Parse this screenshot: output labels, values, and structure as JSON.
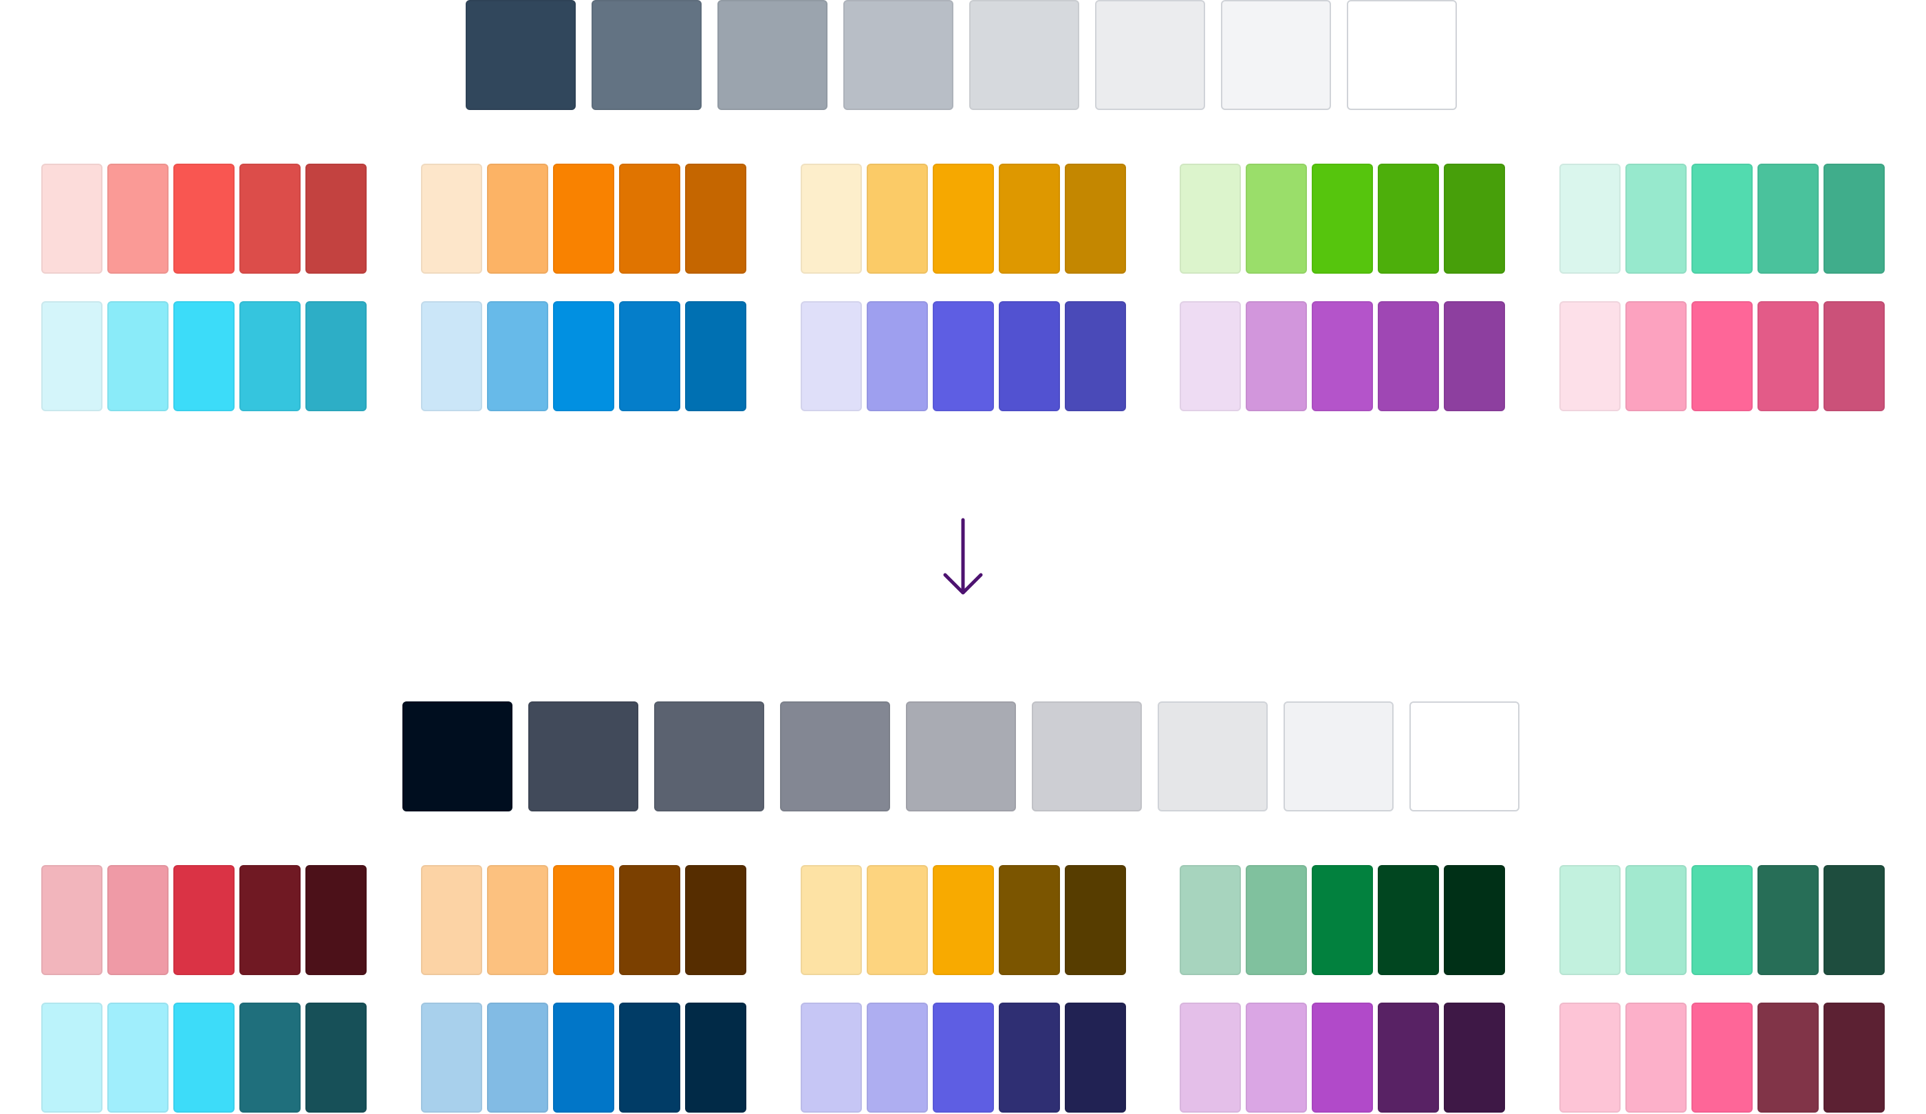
{
  "before": {
    "grays": [
      "#31475c",
      "#637383",
      "#9ba4ae",
      "#b8bec6",
      "#d6d9dd",
      "#ebecee",
      "#f3f4f6",
      "#ffffff"
    ],
    "rows": [
      [
        [
          "#fcdcda",
          "#fa9a96",
          "#f95651",
          "#dc4d4a",
          "#c34240"
        ],
        [
          "#fde6ca",
          "#fcb365",
          "#f98200",
          "#e07400",
          "#c56600"
        ],
        [
          "#fdeecb",
          "#fbcb67",
          "#f6a800",
          "#de9800",
          "#c48700"
        ],
        [
          "#dcf4cc",
          "#9ade6a",
          "#56c50d",
          "#4daf0b",
          "#479f0a"
        ],
        [
          "#daf6ed",
          "#97e9cd",
          "#52dbaf",
          "#4ac29c",
          "#40ad8b"
        ]
      ],
      [
        [
          "#d4f5fa",
          "#8aebf9",
          "#3cdcf9",
          "#35c5de",
          "#2daec6"
        ],
        [
          "#cbe6f8",
          "#67bae9",
          "#0190e1",
          "#057eca",
          "#0070b2"
        ],
        [
          "#dfdff9",
          "#9e9fef",
          "#5e5ee3",
          "#5252d1",
          "#4a4ab8"
        ],
        [
          "#eedcf3",
          "#d296dc",
          "#b454ca",
          "#9f47b4",
          "#8d3f9f"
        ],
        [
          "#fde0e9",
          "#fca2bf",
          "#fe6698",
          "#e35b88",
          "#cb5179"
        ]
      ]
    ]
  },
  "after": {
    "grays": [
      "#000e1f",
      "#414a5a",
      "#5b6270",
      "#838793",
      "#a9abb3",
      "#cdced3",
      "#e5e6e8",
      "#f1f2f4",
      "#ffffff"
    ],
    "rows": [
      [
        [
          "#f2b5bc",
          "#ef9aa6",
          "#da3345",
          "#701923",
          "#4c1119"
        ],
        [
          "#fcd3a5",
          "#fcc17f",
          "#fa8400",
          "#7b4000",
          "#562d00"
        ],
        [
          "#fde2a4",
          "#fdd47f",
          "#f8aa00",
          "#7b5500",
          "#573d00"
        ],
        [
          "#a7d4be",
          "#80c19e",
          "#02813e",
          "#014620",
          "#003017"
        ],
        [
          "#c2f1de",
          "#a2e9cf",
          "#50dcac",
          "#276e57",
          "#1e4d3e"
        ]
      ],
      [
        [
          "#bbf3fb",
          "#a0eefc",
          "#3ddcf9",
          "#1f6f7c",
          "#175058"
        ],
        [
          "#a8d0ec",
          "#82bbe4",
          "#0176c8",
          "#013c66",
          "#012a47"
        ],
        [
          "#c6c6f5",
          "#aeaef1",
          "#5e5ee3",
          "#2f2f73",
          "#212253"
        ],
        [
          "#e4bfe9",
          "#daa6e4",
          "#b14ac9",
          "#582264",
          "#3e1846"
        ],
        [
          "#fdc4d6",
          "#fcb0c9",
          "#fe6698",
          "#813448",
          "#5c2133"
        ]
      ]
    ]
  },
  "arrow_color": "#4d1270"
}
